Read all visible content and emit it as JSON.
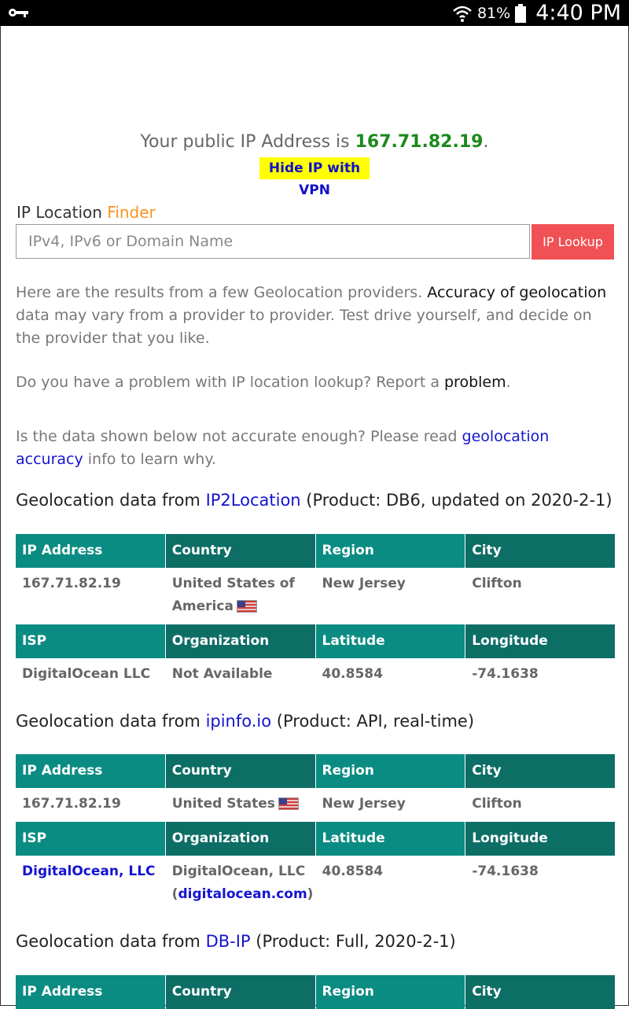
{
  "status_bar": {
    "battery": "81%",
    "time": "4:40 PM"
  },
  "ip_banner": {
    "prefix": "Your public IP Address is ",
    "ip": "167.71.82.19",
    "suffix": ".",
    "vpn_link": "Hide IP with VPN"
  },
  "finder": {
    "title_a": "IP Location ",
    "title_b": "Finder",
    "placeholder": "IPv4, IPv6 or Domain Name",
    "button": "IP Lookup"
  },
  "intro": {
    "p1_a": "Here are the results from a few Geolocation providers. ",
    "p1_link": "Accuracy of geolocation",
    "p1_b": " data may vary from a provider to provider. Test drive yourself, and decide on the provider that you like.",
    "p2_a": "Do you have a problem with IP location lookup? Report a ",
    "p2_link": "problem",
    "p2_b": ".",
    "p3_a": "Is the data shown below not accurate enough? Please read ",
    "p3_link": "geolocation accuracy",
    "p3_b": " info to learn why."
  },
  "providers": [
    {
      "heading_a": "Geolocation data from ",
      "name": "IP2Location",
      "heading_b": " (Product: DB6, updated on 2020-2-1)",
      "headers1": [
        "IP Address",
        "Country",
        "Region",
        "City"
      ],
      "row1": [
        "167.71.82.19",
        "United States of America",
        "New Jersey",
        "Clifton"
      ],
      "headers2": [
        "ISP",
        "Organization",
        "Latitude",
        "Longitude"
      ],
      "row2": [
        "DigitalOcean LLC",
        "Not Available",
        "40.8584",
        "-74.1638"
      ]
    },
    {
      "heading_a": "Geolocation data from ",
      "name": "ipinfo.io",
      "heading_b": " (Product: API, real-time)",
      "headers1": [
        "IP Address",
        "Country",
        "Region",
        "City"
      ],
      "row1": [
        "167.71.82.19",
        "United States",
        "New Jersey",
        "Clifton"
      ],
      "headers2": [
        "ISP",
        "Organization",
        "Latitude",
        "Longitude"
      ],
      "row2": [
        "DigitalOcean, LLC",
        "DigitalOcean, LLC",
        "40.8584",
        "-74.1638"
      ],
      "org_link": "digitalocean.com"
    },
    {
      "heading_a": "Geolocation data from ",
      "name": "DB-IP",
      "heading_b": " (Product: Full, 2020-2-1)",
      "headers1": [
        "IP Address",
        "Country",
        "Region",
        "City"
      ]
    }
  ]
}
